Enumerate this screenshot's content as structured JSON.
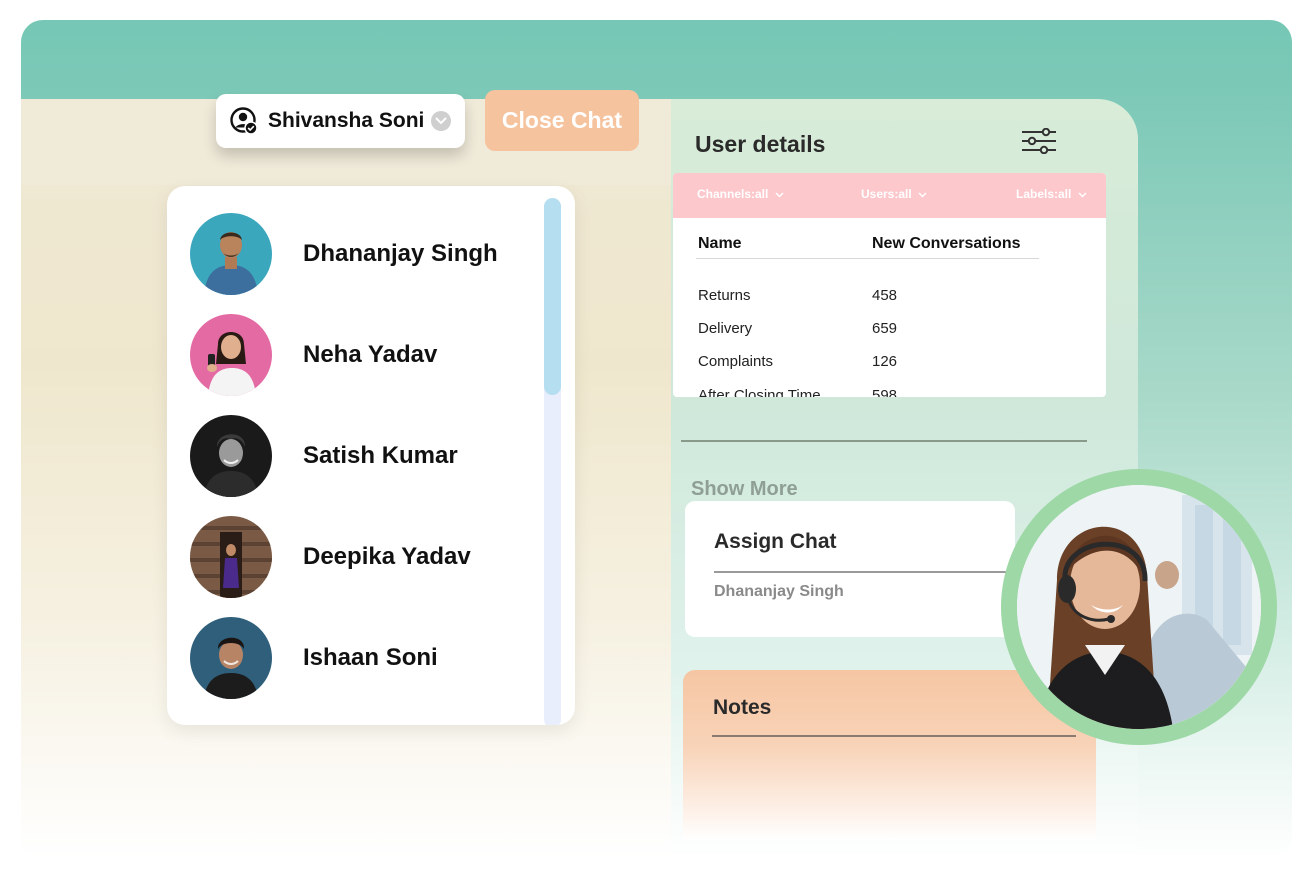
{
  "header": {
    "selected_user": "Shivansha Soni",
    "close_chat_label": "Close Chat"
  },
  "contacts": [
    {
      "name": "Dhananjay Singh"
    },
    {
      "name": "Neha Yadav"
    },
    {
      "name": "Satish Kumar"
    },
    {
      "name": "Deepika Yadav"
    },
    {
      "name": "Ishaan Soni"
    }
  ],
  "user_details": {
    "title": "User details",
    "filters": {
      "channels": "Channels:all",
      "users": "Users:all",
      "labels": "Labels:all"
    },
    "table": {
      "headers": [
        "Name",
        "New Conversations"
      ],
      "rows": [
        [
          "Returns",
          "458"
        ],
        [
          "Delivery",
          "659"
        ],
        [
          "Complaints",
          "126"
        ],
        [
          "After Closing Time",
          "598"
        ]
      ]
    },
    "show_more_label": "Show More"
  },
  "assign_chat": {
    "title": "Assign Chat",
    "value": "Dhananjay Singh"
  },
  "notes": {
    "title": "Notes"
  },
  "colors": {
    "header_teal": "#76c7b5",
    "close_chat_bg": "#f6c39f",
    "filter_bar_pink": "#fcc8cc",
    "scrollbar_thumb": "#b5def0",
    "agent_ring": "#9dd8a6"
  },
  "icons": {
    "user": "user-check-icon",
    "dropdown": "chevron-down-icon",
    "filter": "sliders-icon"
  }
}
